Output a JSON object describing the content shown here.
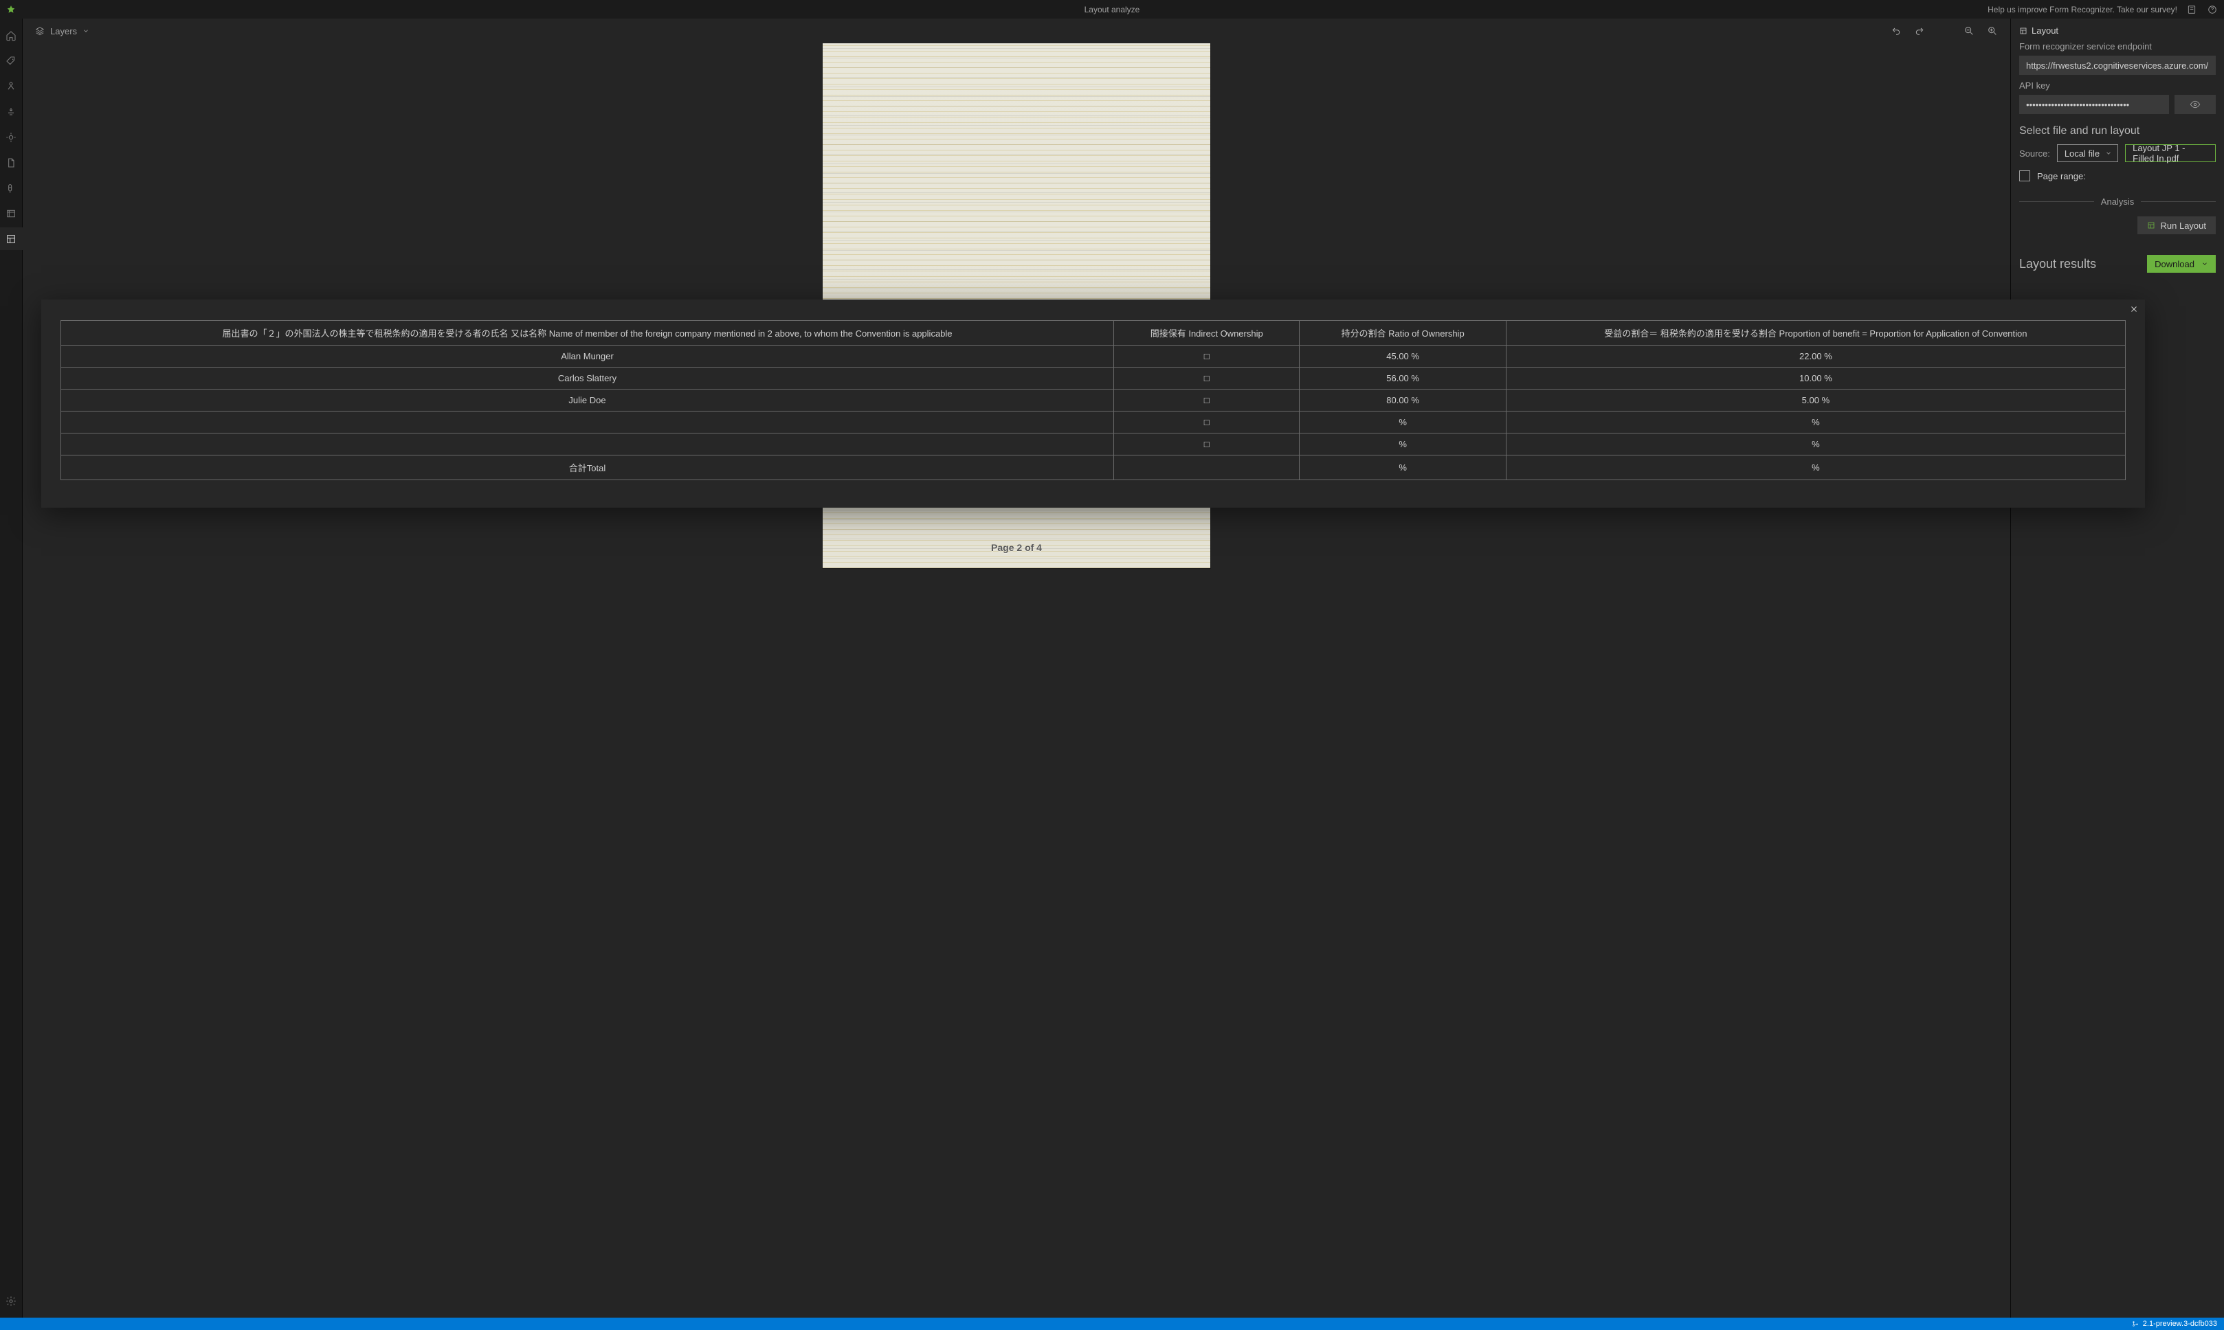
{
  "titlebar": {
    "title": "Layout analyze",
    "survey_text": "Help us improve Form Recognizer. Take our survey!"
  },
  "toolbar": {
    "layers_label": "Layers"
  },
  "doc": {
    "page_label": "Page 2 of 4"
  },
  "rightpanel": {
    "layout_header": "Layout",
    "endpoint_label": "Form recognizer service endpoint",
    "endpoint_value": "https://frwestus2.cognitiveservices.azure.com/",
    "apikey_label": "API key",
    "apikey_value": "•••••••••••••••••••••••••••••••••",
    "select_title": "Select file and run layout",
    "source_label": "Source:",
    "source_value": "Local file",
    "file_value": "Layout JP 1 - Filled In.pdf",
    "pagerange_label": "Page range:",
    "analysis_label": "Analysis",
    "run_label": "Run Layout",
    "results_title": "Layout results",
    "download_label": "Download"
  },
  "statusbar": {
    "version": "2.1-preview.3-dcfb033"
  },
  "modal": {
    "headers": {
      "name": "届出書の「２」の外国法人の株主等で租税条約の適用を受ける者の氏名 又は名称 Name of member of the foreign company mentioned in 2 above, to whom the Convention is applicable",
      "indirect": "間接保有 Indirect Ownership",
      "ratio": "持分の割合 Ratio of Ownership",
      "benefit": "受益の割合＝ 租税条約の適用を受ける割合 Proportion of benefit = Proportion for Application of Convention"
    },
    "rows": [
      {
        "name": "Allan Munger",
        "indirect": "□",
        "ratio": "45.00 %",
        "benefit": "22.00 %"
      },
      {
        "name": "Carlos Slattery",
        "indirect": "□",
        "ratio": "56.00 %",
        "benefit": "10.00 %"
      },
      {
        "name": "Julie Doe",
        "indirect": "□",
        "ratio": "80.00 %",
        "benefit": "5.00 %"
      },
      {
        "name": "",
        "indirect": "□",
        "ratio": "%",
        "benefit": "%"
      },
      {
        "name": "",
        "indirect": "□",
        "ratio": "%",
        "benefit": "%"
      },
      {
        "name": "合計Total",
        "indirect": "",
        "ratio": "%",
        "benefit": "%"
      }
    ]
  }
}
